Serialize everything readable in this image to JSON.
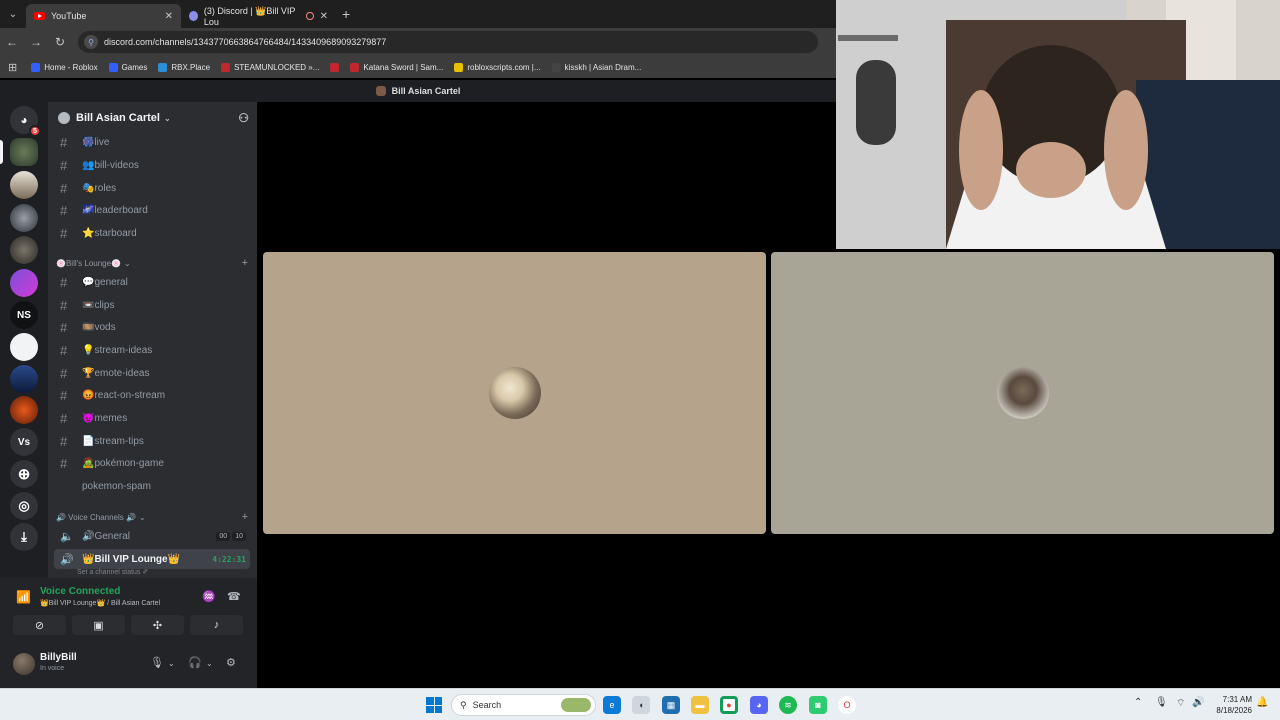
{
  "browser": {
    "tabs": [
      {
        "label": "YouTube",
        "icon": "youtube-icon"
      },
      {
        "label": "(3) Discord | 👑Bill VIP Lou",
        "icon": "discord-icon"
      }
    ],
    "url": "discord.com/channels/1343770663864766484/1433409689093279877",
    "bookmarks": [
      {
        "label": "Home - Roblox",
        "color": "#335fff"
      },
      {
        "label": "Games",
        "color": "#335fff"
      },
      {
        "label": "RBX.Place",
        "color": "#2c8fd6"
      },
      {
        "label": "STEAMUNLOCKED »...",
        "color": "#c0282d"
      },
      {
        "label": "",
        "color": "#c0282d"
      },
      {
        "label": "Katana Sword | Sam...",
        "color": "#c0282d"
      },
      {
        "label": "robloxscripts.com |...",
        "color": "#e8c200"
      },
      {
        "label": "kisskh | Asian Dram...",
        "color": "#444444"
      }
    ]
  },
  "discord": {
    "window_title": "Bill Asian Cartel",
    "rail": {
      "home_badge": "5",
      "servers": [
        "server-1",
        "server-2",
        "server-3",
        "server-4",
        "server-5",
        "NS",
        "server-7",
        "server-8",
        "server-9",
        "Vs"
      ]
    },
    "guild_name": "Bill Asian Cartel",
    "channels_top": [
      {
        "label": "🎆live"
      },
      {
        "label": "👥bill-videos"
      },
      {
        "label": "🎭roles"
      },
      {
        "label": "🌌leaderboard"
      },
      {
        "label": "⭐starboard"
      }
    ],
    "category_lounge": "🍥Bill's Lounge🍥",
    "channels_lounge": [
      {
        "label": "💬general"
      },
      {
        "label": "📼clips"
      },
      {
        "label": "🎞️vods"
      },
      {
        "label": "💡stream-ideas"
      },
      {
        "label": "🏆emote-ideas"
      },
      {
        "label": "😡react-on-stream"
      },
      {
        "label": "😈memes"
      },
      {
        "label": "📄stream-tips"
      },
      {
        "label": "🧟pokémon-game"
      },
      {
        "label": "pokemon-spam"
      }
    ],
    "category_voice": "🔊 Voice Channels 🔊",
    "voice_channels": [
      {
        "label": "🔊General",
        "count_a": "00",
        "count_b": "10"
      },
      {
        "label": "👑Bill VIP Lounge👑",
        "timer": "4:22:31",
        "status": "Set a channel status ✐"
      }
    ],
    "voice_panel": {
      "status": "Voice Connected",
      "location": "👑Bill VIP Lounge👑 / Bill Asian Cartel"
    },
    "user": {
      "name": "BillyBill",
      "status": "In voice"
    },
    "tiles": [
      {
        "bg": "#b5a38c"
      },
      {
        "bg": "#a8a596"
      }
    ]
  },
  "taskbar": {
    "search_label": "Search",
    "time": "7:31 AM",
    "date": "8/18/2026"
  }
}
